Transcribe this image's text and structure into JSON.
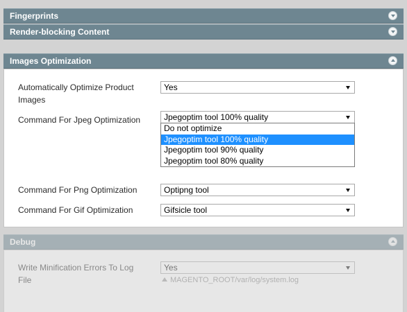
{
  "sections": {
    "fingerprints": {
      "title": "Fingerprints"
    },
    "render_blocking": {
      "title": "Render-blocking Content"
    },
    "images": {
      "title": "Images Optimization",
      "fields": {
        "auto_optimize": {
          "label": "Automatically Optimize Product Images",
          "value": "Yes"
        },
        "jpeg": {
          "label": "Command For Jpeg Optimization",
          "value": "Jpegoptim tool 100% quality",
          "options": [
            "Do not optimize",
            "Jpegoptim tool 100% quality",
            "Jpegoptim tool 90% quality",
            "Jpegoptim tool 80% quality"
          ],
          "highlighted_option": "Jpegoptim tool 100% quality"
        },
        "png": {
          "label": "Command For Png Optimization",
          "value": "Optipng tool"
        },
        "gif": {
          "label": "Command For Gif Optimization",
          "value": "Gifsicle tool"
        }
      }
    },
    "debug": {
      "title": "Debug",
      "fields": {
        "write_errors": {
          "label": "Write Minification Errors To Log File",
          "value": "Yes",
          "note": "MAGENTO_ROOT/var/log/system.log"
        }
      }
    }
  },
  "colors": {
    "header_bg": "#6e8691",
    "highlight": "#1e90ff",
    "page_bg": "#d3d3d3"
  }
}
